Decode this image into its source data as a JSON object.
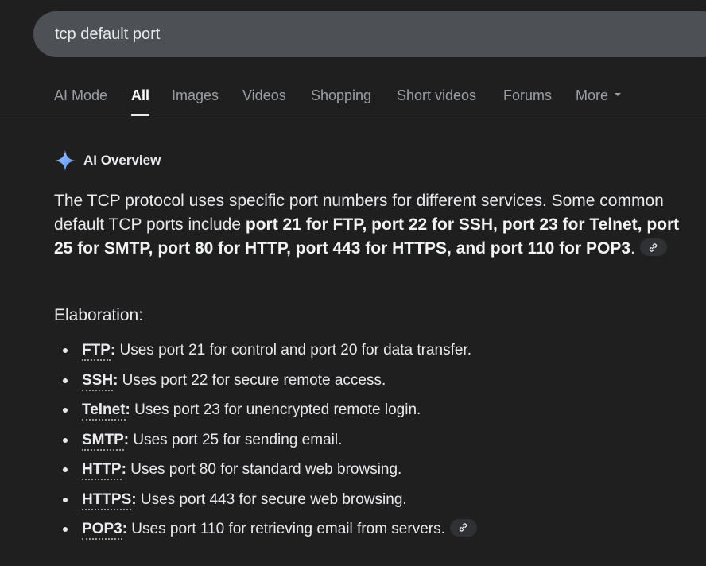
{
  "search": {
    "query": "tcp default port"
  },
  "tabs": [
    {
      "label": "AI Mode"
    },
    {
      "label": "All"
    },
    {
      "label": "Images"
    },
    {
      "label": "Videos"
    },
    {
      "label": "Shopping"
    },
    {
      "label": "Short videos"
    },
    {
      "label": "Forums"
    },
    {
      "label": "More"
    }
  ],
  "ai_overview": {
    "title": "AI Overview",
    "icon": "sparkle-icon",
    "accent_color": "#8ab4f8",
    "summary_plain_1": "The TCP protocol uses specific port numbers for different services. Some common default TCP ports include ",
    "summary_bold": "port 21 for FTP, port 22 for SSH, port 23 for Telnet, port 25 for SMTP, port 80 for HTTP, port 443 for HTTPS, and port 110 for POP3",
    "summary_plain_2": ".",
    "elaboration_heading": "Elaboration:",
    "items": [
      {
        "term": "FTP",
        "desc": " Uses port 21 for control and port 20 for data transfer."
      },
      {
        "term": "SSH",
        "desc": " Uses port 22 for secure remote access."
      },
      {
        "term": "Telnet",
        "desc": " Uses port 23 for unencrypted remote login."
      },
      {
        "term": "SMTP",
        "desc": " Uses port 25 for sending email."
      },
      {
        "term": "HTTP",
        "desc": " Uses port 80 for standard web browsing."
      },
      {
        "term": "HTTPS",
        "desc": " Uses port 443 for secure web browsing."
      },
      {
        "term": "POP3",
        "desc": " Uses port 110 for retrieving email from servers."
      }
    ]
  }
}
